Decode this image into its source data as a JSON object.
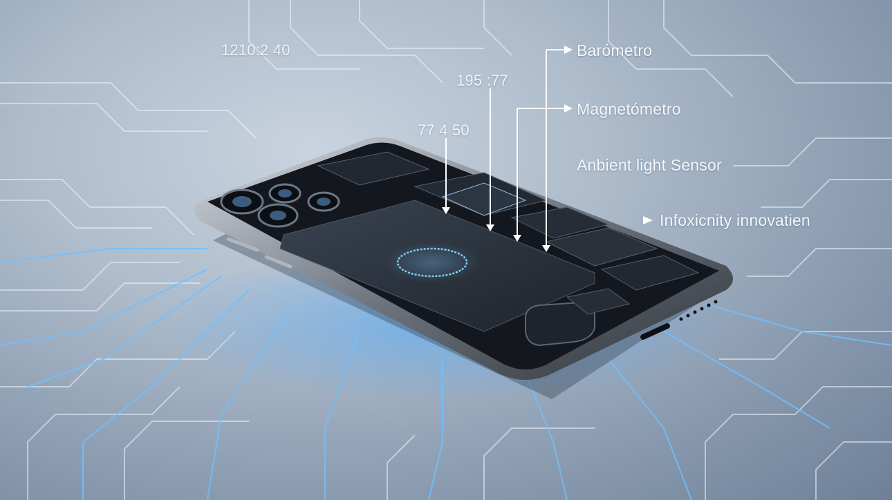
{
  "annotations": {
    "timestamp": "1210:2 40",
    "reading_a": "195 :77",
    "reading_b": "77 4 50",
    "barometer": "Barómetro",
    "magnetometer": "Magnetómetro",
    "ambient_light": "Anbient light Sensor",
    "innovation": "Infoxicnity innovatien"
  },
  "colors": {
    "background": "#9aabbf",
    "circuit_trace": "#e6f0fa",
    "circuit_glow": "#5fb4f0",
    "phone_frame": "#4a5058",
    "phone_interior": "#15191f",
    "pointer_lines": "#ffffff"
  },
  "icons": [
    "arrow-right-icon",
    "arrow-down-icon",
    "lens-icon",
    "glow-ring-icon"
  ]
}
